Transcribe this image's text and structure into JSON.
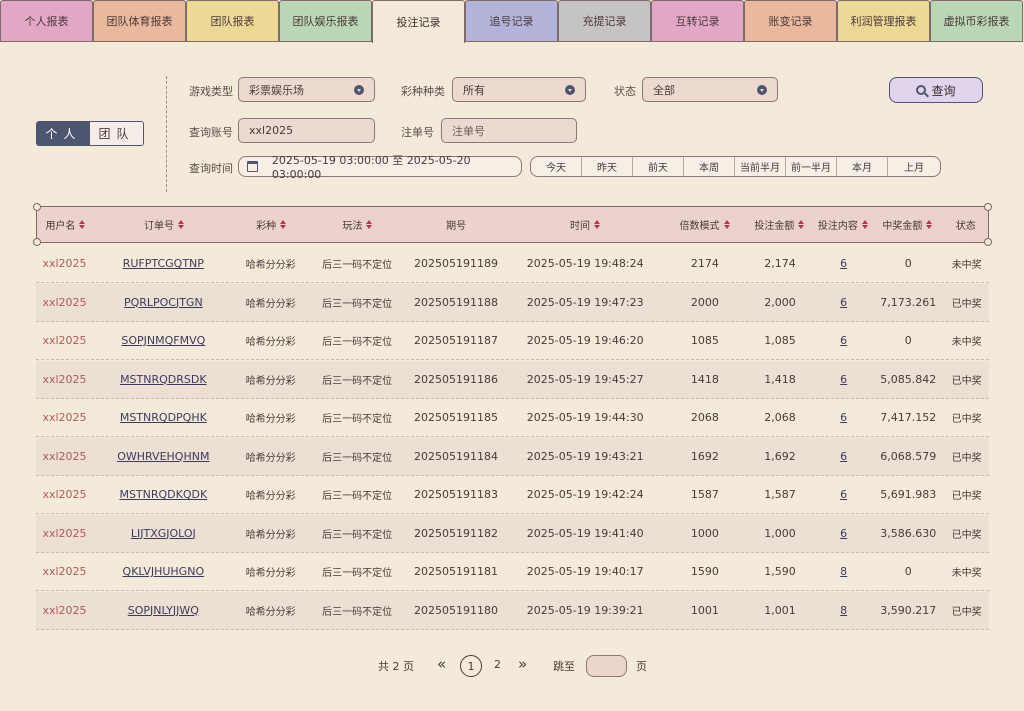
{
  "tabs": [
    "个人报表",
    "团队体育报表",
    "团队报表",
    "团队娱乐报表",
    "投注记录",
    "追号记录",
    "充提记录",
    "互转记录",
    "账变记录",
    "利润管理报表",
    "虚拟币彩报表"
  ],
  "tab_colors": [
    "#e2a7c4",
    "#e9b99e",
    "#ecd995",
    "#b9d6b6",
    "#f4ead9",
    "#b3b3da",
    "#c5c3c3",
    "#e2a7c4",
    "#e9b99e",
    "#ecd995",
    "#b9d6b6"
  ],
  "toggle": {
    "personal": "个人",
    "team": "团队"
  },
  "filters": {
    "game_type_label": "游戏类型",
    "game_type_value": "彩票娱乐场",
    "lottery_label": "彩种种类",
    "lottery_value": "所有",
    "status_label": "状态",
    "status_value": "全部",
    "account_label": "查询账号",
    "account_value": "xxl2025",
    "order_label": "注单号",
    "order_placeholder": "注单号",
    "time_label": "查询时间",
    "time_value": "2025-05-19 03:00:00 至 2025-05-20 03:00:00",
    "search_label": "查询",
    "quick_ranges": [
      "今天",
      "昨天",
      "前天",
      "本周",
      "当前半月",
      "前一半月",
      "本月",
      "上月"
    ]
  },
  "table": {
    "headers": [
      "用户名",
      "订单号",
      "彩种",
      "玩法",
      "期号",
      "时间",
      "倍数模式",
      "投注金额",
      "投注内容",
      "中奖金额",
      "状态"
    ],
    "rows": [
      [
        "xxl2025",
        "RUFPTCGQTNP",
        "哈希分分彩",
        "后三一码不定位",
        "202505191189",
        "2025-05-19 19:48:24",
        "2174",
        "2,174",
        "6",
        "0",
        "未中奖"
      ],
      [
        "xxl2025",
        "PQRLPOCJTGN",
        "哈希分分彩",
        "后三一码不定位",
        "202505191188",
        "2025-05-19 19:47:23",
        "2000",
        "2,000",
        "6",
        "7,173.261",
        "已中奖"
      ],
      [
        "xxl2025",
        "SOPJNMQFMVQ",
        "哈希分分彩",
        "后三一码不定位",
        "202505191187",
        "2025-05-19 19:46:20",
        "1085",
        "1,085",
        "6",
        "0",
        "未中奖"
      ],
      [
        "xxl2025",
        "MSTNRQDRSDK",
        "哈希分分彩",
        "后三一码不定位",
        "202505191186",
        "2025-05-19 19:45:27",
        "1418",
        "1,418",
        "6",
        "5,085.842",
        "已中奖"
      ],
      [
        "xxl2025",
        "MSTNRQDPQHK",
        "哈希分分彩",
        "后三一码不定位",
        "202505191185",
        "2025-05-19 19:44:30",
        "2068",
        "2,068",
        "6",
        "7,417.152",
        "已中奖"
      ],
      [
        "xxl2025",
        "OWHRVEHQHNM",
        "哈希分分彩",
        "后三一码不定位",
        "202505191184",
        "2025-05-19 19:43:21",
        "1692",
        "1,692",
        "6",
        "6,068.579",
        "已中奖"
      ],
      [
        "xxl2025",
        "MSTNRQDKQDK",
        "哈希分分彩",
        "后三一码不定位",
        "202505191183",
        "2025-05-19 19:42:24",
        "1587",
        "1,587",
        "6",
        "5,691.983",
        "已中奖"
      ],
      [
        "xxl2025",
        "LIJTXGJOLOJ",
        "哈希分分彩",
        "后三一码不定位",
        "202505191182",
        "2025-05-19 19:41:40",
        "1000",
        "1,000",
        "6",
        "3,586.630",
        "已中奖"
      ],
      [
        "xxl2025",
        "QKLVJHUHGNO",
        "哈希分分彩",
        "后三一码不定位",
        "202505191181",
        "2025-05-19 19:40:17",
        "1590",
        "1,590",
        "8",
        "0",
        "未中奖"
      ],
      [
        "xxl2025",
        "SOPJNLYJJWQ",
        "哈希分分彩",
        "后三一码不定位",
        "202505191180",
        "2025-05-19 19:39:21",
        "1001",
        "1,001",
        "8",
        "3,590.217",
        "已中奖"
      ]
    ]
  },
  "pager": {
    "total": "共 2 页",
    "prev": "«",
    "current": "1",
    "next_page": "2",
    "next": "»",
    "jump_label": "跳至",
    "page_suffix": "页"
  }
}
